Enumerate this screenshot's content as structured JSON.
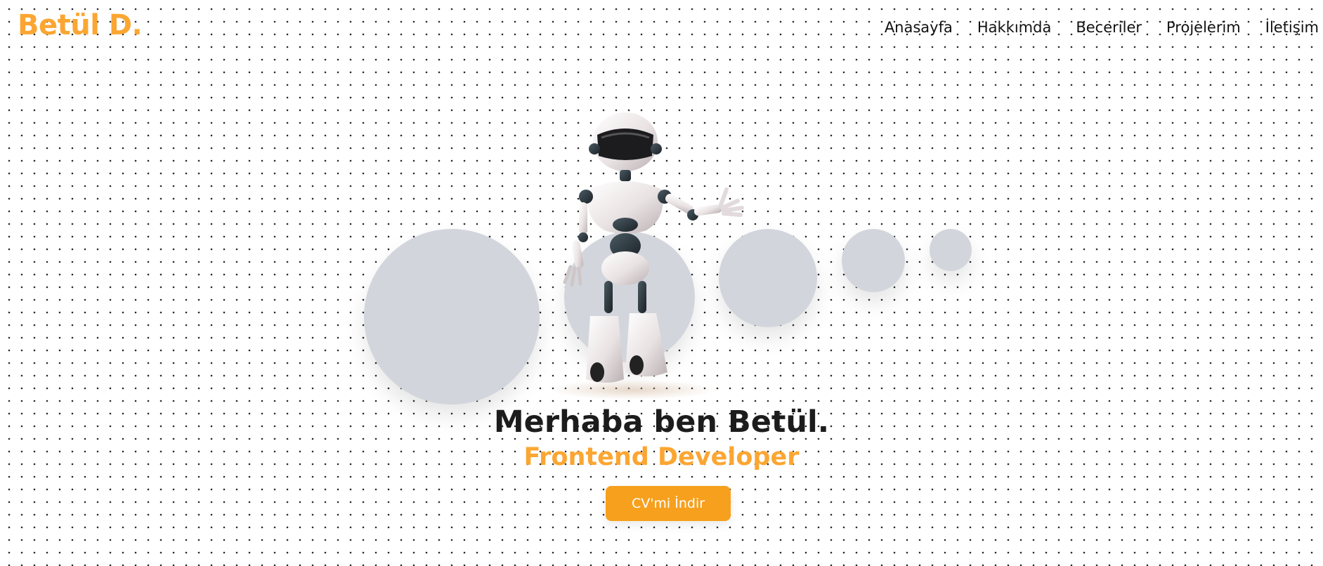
{
  "brand": {
    "logo": "Betül D."
  },
  "nav": {
    "items": [
      {
        "label": "Anasayfa"
      },
      {
        "label": "Hakkımda"
      },
      {
        "label": "Beceriler"
      },
      {
        "label": "Projelerim"
      },
      {
        "label": "İletişim"
      }
    ]
  },
  "hero": {
    "title": "Merhaba ben Betül.",
    "subtitle": "Frontend Developer",
    "cta_label": "CV'mi İndir"
  },
  "colors": {
    "accent": "#fba632",
    "button": "#f7a01d",
    "bubble": "#d2d6dc",
    "text": "#1c1c1c"
  },
  "icons": {
    "hero_illustration": "robot-illustration"
  }
}
